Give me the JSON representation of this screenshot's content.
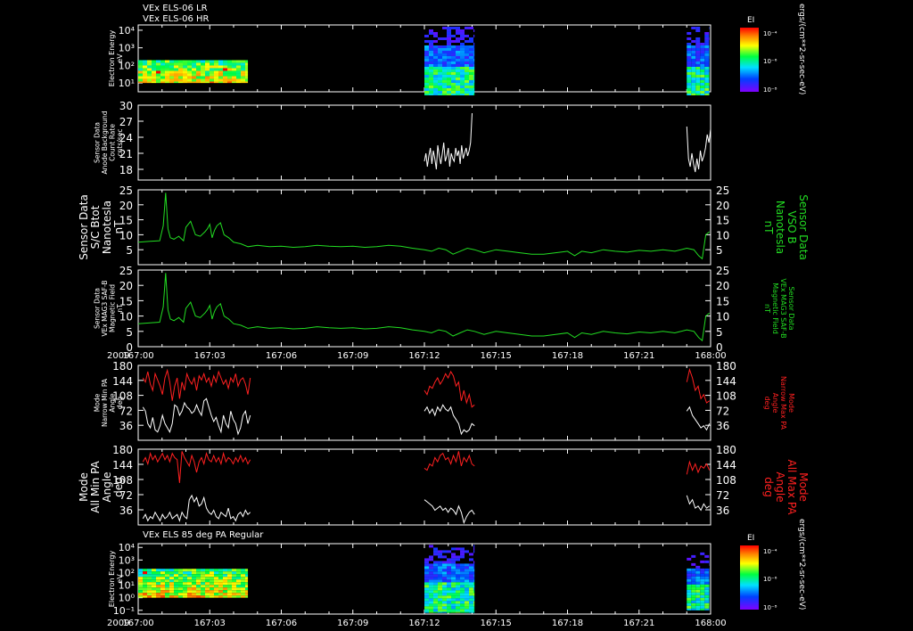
{
  "header": {
    "title_line1": "VEx ELS-06 LR",
    "title_line2": "VEx ELS-06 HR",
    "bottom_title": "VEx ELS 85 deg PA Regular"
  },
  "colorbar": {
    "label": "EI",
    "ticks": [
      "10⁻⁴",
      "10⁻⁶",
      "10⁻⁸"
    ],
    "units": "ergs/(cm**2-sr-sec-eV)"
  },
  "chart_data": [
    {
      "type": "heatmap",
      "name": "panel1",
      "ylabel": [
        "Electron Energy",
        "eV"
      ],
      "ytick_labels": [
        "10⁴",
        "10³",
        "10²",
        "10¹"
      ],
      "ylog_range": [
        0.5,
        4.3
      ],
      "segments": [
        {
          "x_start": 0.0,
          "x_end": 4.6,
          "e_low": 1.0,
          "e_high": 2.3
        },
        {
          "x_start": 12.0,
          "x_end": 14.1,
          "e_low": 0.3,
          "e_high": 4.2
        },
        {
          "x_start": 23.0,
          "x_end": 23.95,
          "e_low": 0.3,
          "e_high": 4.2
        }
      ]
    },
    {
      "type": "line",
      "name": "panel2",
      "ylabel": [
        "Sensor Data",
        "Anode Background",
        "Count Rate",
        "cnts/sec"
      ],
      "ylim": [
        16,
        30
      ],
      "yticks": [
        18,
        21,
        24,
        27,
        30
      ],
      "color": "#ffffff",
      "segments": [
        {
          "x_start": 12.0,
          "x_end": 14.0,
          "values": [
            19.5,
            21,
            18.5,
            20.5,
            22,
            19,
            21.5,
            20,
            18,
            22.5,
            20.5,
            19,
            21,
            23,
            19.5,
            20.5,
            22,
            18.5,
            21,
            20,
            19.5,
            22,
            20.5,
            21.5,
            19,
            22.5,
            20,
            21,
            22,
            20.5,
            21.5,
            23,
            28.5
          ]
        },
        {
          "x_start": 23.0,
          "x_end": 24.0,
          "values": [
            26,
            20,
            18.5,
            21,
            19,
            17.5,
            20,
            18,
            21.5,
            19.5,
            20.5,
            22,
            24.5,
            23,
            25.5
          ]
        }
      ]
    },
    {
      "type": "line",
      "name": "panel3",
      "ylabel": [
        "Sensor Data",
        "S/C Btot",
        "Nanotesla",
        "nT"
      ],
      "right_label": [
        "Sensor Data",
        "VSO B",
        "Nanotesla",
        "nT"
      ],
      "ylim": [
        0,
        25
      ],
      "yticks": [
        5,
        10,
        15,
        20,
        25
      ],
      "color": "#22dd22",
      "x": [
        0,
        0.5,
        0.9,
        1.05,
        1.15,
        1.25,
        1.35,
        1.5,
        1.7,
        1.9,
        2.0,
        2.2,
        2.4,
        2.6,
        2.8,
        2.9,
        3.0,
        3.1,
        3.2,
        3.3,
        3.45,
        3.6,
        3.8,
        4.0,
        4.3,
        4.6,
        5,
        5.5,
        6,
        6.5,
        7,
        7.5,
        8,
        8.5,
        9,
        9.5,
        10,
        10.5,
        11,
        11.5,
        12,
        12.3,
        12.6,
        12.9,
        13.2,
        13.5,
        13.8,
        14.1,
        14.5,
        15,
        15.5,
        16,
        16.5,
        17,
        17.5,
        18,
        18.3,
        18.6,
        19,
        19.5,
        20,
        20.5,
        21,
        21.5,
        22,
        22.5,
        23,
        23.3,
        23.5,
        23.65,
        23.8,
        23.95
      ],
      "y": [
        7.5,
        7.8,
        8,
        13,
        24,
        12,
        9,
        8.5,
        9.5,
        8,
        12.5,
        14.5,
        10,
        9.5,
        11,
        12,
        13.5,
        9,
        11.5,
        13,
        14,
        10,
        9,
        7.5,
        7,
        6,
        6.5,
        6,
        6.2,
        5.8,
        6,
        6.5,
        6.2,
        6,
        6.2,
        5.8,
        6,
        6.5,
        6.2,
        5.5,
        5,
        4.5,
        5.5,
        5,
        3.5,
        4.5,
        5.5,
        5,
        4,
        5,
        4.5,
        4,
        3.5,
        3.5,
        4,
        4.5,
        3,
        4.5,
        4,
        5,
        4.5,
        4.2,
        4.8,
        4.5,
        5,
        4.5,
        5.5,
        5,
        3,
        2,
        10,
        11
      ]
    },
    {
      "type": "line",
      "name": "panel4",
      "ylabel": [
        "Sensor Data",
        "VEx MAG3 SAF-B",
        "Magnetic Field",
        "nT"
      ],
      "right_label": [
        "Sensor Data",
        "VEx MAG3 SAF-B",
        "Magnetic Field",
        "nT"
      ],
      "ylim": [
        0,
        25
      ],
      "yticks": [
        0,
        5,
        10,
        15,
        20,
        25
      ],
      "color": "#22dd22",
      "x": [
        0,
        0.5,
        0.9,
        1.05,
        1.15,
        1.25,
        1.35,
        1.5,
        1.7,
        1.9,
        2.0,
        2.2,
        2.4,
        2.6,
        2.8,
        2.9,
        3.0,
        3.1,
        3.2,
        3.3,
        3.45,
        3.6,
        3.8,
        4.0,
        4.3,
        4.6,
        5,
        5.5,
        6,
        6.5,
        7,
        7.5,
        8,
        8.5,
        9,
        9.5,
        10,
        10.5,
        11,
        11.5,
        12,
        12.3,
        12.6,
        12.9,
        13.2,
        13.5,
        13.8,
        14.1,
        14.5,
        15,
        15.5,
        16,
        16.5,
        17,
        17.5,
        18,
        18.3,
        18.6,
        19,
        19.5,
        20,
        20.5,
        21,
        21.5,
        22,
        22.5,
        23,
        23.3,
        23.5,
        23.65,
        23.8,
        23.95
      ],
      "y": [
        7.5,
        7.8,
        8,
        13,
        24,
        12,
        9,
        8.5,
        9.5,
        8,
        12.5,
        14.5,
        10,
        9.5,
        11,
        12,
        13.5,
        9,
        11.5,
        13,
        14,
        10,
        9,
        7.5,
        7,
        6,
        6.5,
        6,
        6.2,
        5.8,
        6,
        6.5,
        6.2,
        6,
        6.2,
        5.8,
        6,
        6.5,
        6.2,
        5.5,
        5,
        4.5,
        5.5,
        5,
        3.5,
        4.5,
        5.5,
        5,
        4,
        5,
        4.5,
        4,
        3.5,
        3.5,
        4,
        4.5,
        3,
        4.5,
        4,
        5,
        4.5,
        4.2,
        4.8,
        4.5,
        5,
        4.5,
        5.5,
        5,
        3,
        2,
        10,
        11
      ],
      "year_label": "2009",
      "xtick_labels": [
        "167:00",
        "167:03",
        "167:06",
        "167:09",
        "167:12",
        "167:15",
        "167:18",
        "167:21",
        "168:00"
      ]
    },
    {
      "type": "line",
      "name": "panel5",
      "ylabel": [
        "Mode",
        "Narrow Min PA",
        "Angle",
        "deg"
      ],
      "right_label": [
        "Mode",
        "Narrow Max PA",
        "Angle",
        "deg"
      ],
      "ylim": [
        0,
        180
      ],
      "yticks": [
        36,
        72,
        108,
        144,
        180
      ],
      "series": [
        {
          "color": "#ff2020",
          "segments": [
            {
              "x_start": 0.2,
              "x_end": 4.7,
              "values": [
                150,
                140,
                165,
                135,
                120,
                160,
                145,
                130,
                110,
                150,
                168,
                140,
                95,
                130,
                150,
                100,
                140,
                120,
                160,
                145,
                135,
                150,
                120,
                155,
                145,
                160,
                140,
                150,
                130,
                155,
                140,
                165,
                150,
                135,
                145,
                125,
                150,
                140,
                160,
                130,
                145,
                150,
                135,
                110,
                150
              ]
            },
            {
              "x_start": 12.0,
              "x_end": 14.1,
              "values": [
                120,
                110,
                130,
                125,
                140,
                150,
                135,
                145,
                160,
                150,
                165,
                155,
                130,
                140,
                95,
                120,
                90,
                110,
                80,
                85
              ]
            },
            {
              "x_start": 23.0,
              "x_end": 23.95,
              "values": [
                140,
                170,
                150,
                120,
                130,
                100,
                110,
                90,
                95
              ]
            }
          ]
        },
        {
          "color": "#ffffff",
          "segments": [
            {
              "x_start": 0.2,
              "x_end": 4.7,
              "values": [
                80,
                70,
                40,
                30,
                55,
                25,
                20,
                35,
                60,
                40,
                30,
                20,
                40,
                85,
                80,
                60,
                70,
                90,
                80,
                75,
                65,
                70,
                85,
                70,
                60,
                95,
                100,
                80,
                60,
                45,
                55,
                35,
                20,
                60,
                40,
                30,
                70,
                50,
                40,
                15,
                30,
                60,
                70,
                40,
                60
              ]
            },
            {
              "x_start": 12.0,
              "x_end": 14.1,
              "values": [
                70,
                80,
                65,
                75,
                60,
                80,
                70,
                85,
                75,
                70,
                80,
                60,
                50,
                40,
                15,
                25,
                20,
                25,
                40,
                35
              ]
            },
            {
              "x_start": 23.0,
              "x_end": 23.95,
              "values": [
                70,
                80,
                60,
                50,
                40,
                30,
                35,
                25,
                40
              ]
            }
          ]
        }
      ]
    },
    {
      "type": "line",
      "name": "panel6",
      "ylabel": [
        "Mode",
        "All Min PA",
        "Angle",
        "deg"
      ],
      "right_label": [
        "Mode",
        "All Max PA",
        "Angle",
        "deg"
      ],
      "ylim": [
        0,
        180
      ],
      "yticks": [
        36,
        72,
        108,
        144,
        180
      ],
      "series": [
        {
          "color": "#ff2020",
          "segments": [
            {
              "x_start": 0.2,
              "x_end": 4.7,
              "values": [
                150,
                160,
                145,
                170,
                155,
                165,
                150,
                160,
                170,
                155,
                165,
                150,
                170,
                160,
                155,
                100,
                175,
                160,
                150,
                140,
                165,
                150,
                125,
                150,
                160,
                145,
                170,
                155,
                150,
                165,
                150,
                160,
                145,
                170,
                150,
                160,
                155,
                145,
                160,
                150,
                165,
                150,
                160,
                145,
                155
              ]
            },
            {
              "x_start": 12.0,
              "x_end": 14.1,
              "values": [
                135,
                130,
                145,
                140,
                160,
                150,
                165,
                170,
                155,
                160,
                145,
                165,
                150,
                175,
                140,
                160,
                150,
                165,
                145,
                140
              ]
            },
            {
              "x_start": 23.0,
              "x_end": 23.95,
              "values": [
                120,
                150,
                130,
                145,
                125,
                140,
                135,
                145,
                130
              ]
            }
          ]
        },
        {
          "color": "#ffffff",
          "segments": [
            {
              "x_start": 0.2,
              "x_end": 4.7,
              "values": [
                15,
                25,
                10,
                20,
                15,
                30,
                20,
                10,
                25,
                15,
                20,
                30,
                15,
                20,
                25,
                10,
                30,
                20,
                15,
                60,
                70,
                55,
                65,
                45,
                50,
                65,
                40,
                30,
                25,
                35,
                20,
                15,
                30,
                25,
                20,
                40,
                15,
                20,
                10,
                25,
                30,
                20,
                35,
                25,
                30
              ]
            },
            {
              "x_start": 12.0,
              "x_end": 14.1,
              "values": [
                60,
                55,
                50,
                45,
                35,
                40,
                45,
                35,
                40,
                30,
                40,
                35,
                25,
                45,
                30,
                5,
                20,
                30,
                35,
                25
              ]
            },
            {
              "x_start": 23.0,
              "x_end": 23.95,
              "values": [
                70,
                50,
                60,
                40,
                45,
                35,
                50,
                40,
                45
              ]
            }
          ]
        }
      ]
    },
    {
      "type": "heatmap",
      "name": "panel7",
      "ylabel": [
        "Electron Energy",
        "eV"
      ],
      "ytick_labels": [
        "10⁴",
        "10³",
        "10²",
        "10¹",
        "10⁰",
        "10⁻¹"
      ],
      "ylog_range": [
        -1.3,
        4.3
      ],
      "year_label": "2009",
      "xtick_labels": [
        "167:00",
        "167:03",
        "167:06",
        "167:09",
        "167:12",
        "167:15",
        "167:18",
        "167:21",
        "168:00"
      ],
      "segments": [
        {
          "x_start": 0.0,
          "x_end": 4.6,
          "e_low": 0.0,
          "e_high": 2.3
        },
        {
          "x_start": 12.0,
          "x_end": 14.1,
          "e_low": -1.2,
          "e_high": 4.2
        },
        {
          "x_start": 23.0,
          "x_end": 23.95,
          "e_low": -1.0,
          "e_high": 3.6
        }
      ]
    }
  ]
}
